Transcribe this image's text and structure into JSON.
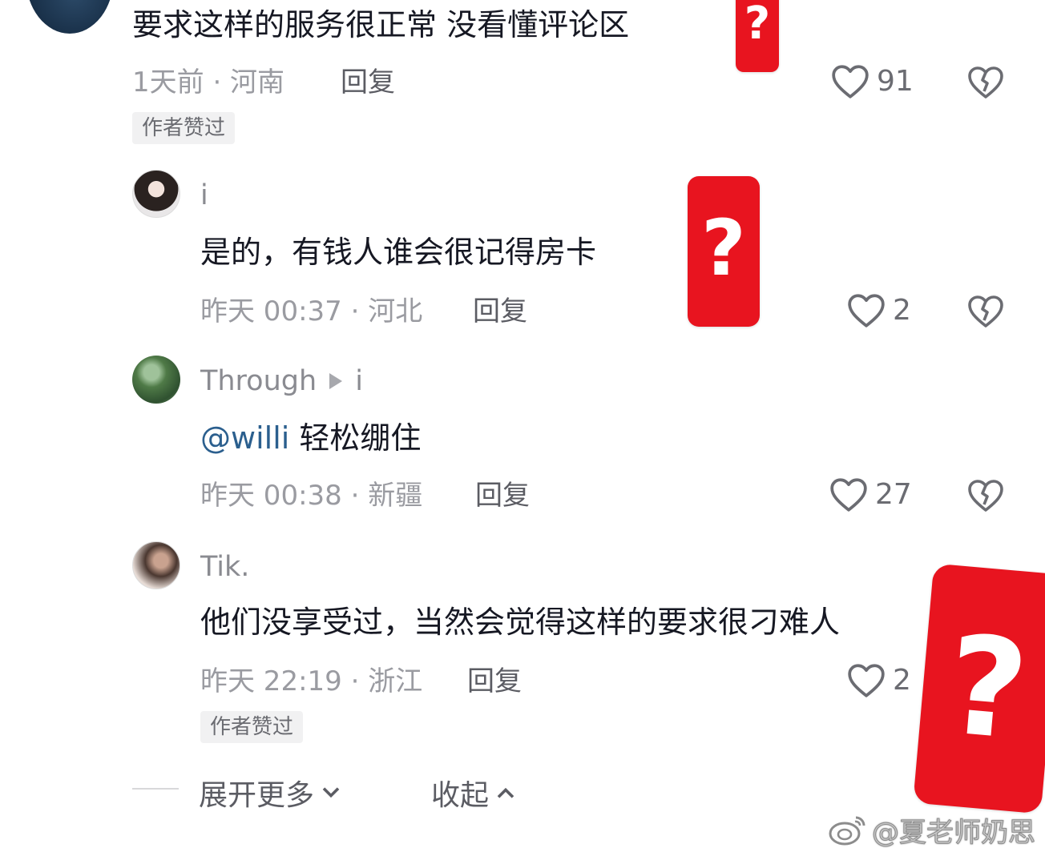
{
  "comments": [
    {
      "username": "",
      "text": "要求这样的服务很正常 没看懂评论区",
      "meta": "1天前 · 河南",
      "reply_label": "回复",
      "likes": "91",
      "badge": "作者赞过"
    },
    {
      "username": "i",
      "text": "是的，有钱人谁会很记得房卡",
      "meta": "昨天 00:37 · 河北",
      "reply_label": "回复",
      "likes": "2"
    },
    {
      "username": "Through",
      "reply_to": "i",
      "mention": "@willi",
      "text": " 轻松绷住",
      "meta": "昨天 00:38 · 新疆",
      "reply_label": "回复",
      "likes": "27"
    },
    {
      "username": "Tik.",
      "text": "他们没享受过，当然会觉得这样的要求很刁难人",
      "meta": "昨天 22:19 · 浙江",
      "reply_label": "回复",
      "likes": "2",
      "badge": "作者赞过"
    }
  ],
  "footer": {
    "expand_label": "展开更多",
    "collapse_label": "收起"
  },
  "overlay": {
    "question_mark": "?",
    "card_color": "#e8141f"
  },
  "watermark": {
    "text": "@夏老师奶思"
  },
  "icons": {
    "like": "heart-outline-icon",
    "dislike": "broken-heart-icon",
    "reply_arrow": "play-triangle-icon",
    "expand": "chevron-down-icon",
    "collapse": "chevron-up-icon",
    "watermark_logo": "weibo-logo-icon"
  }
}
